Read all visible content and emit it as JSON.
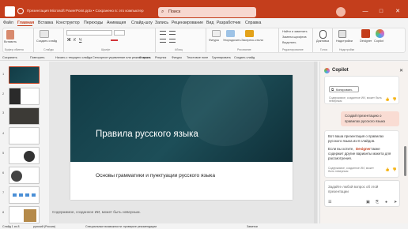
{
  "window": {
    "title": "Презентация Microsoft PowerPoint.pptx • Сохранено в: это компьютер",
    "search_placeholder": "Поиск",
    "minimize": "—",
    "maximize": "□",
    "close": "✕"
  },
  "ribbon": {
    "tabs": [
      "Файл",
      "Главная",
      "Вставка",
      "Конструктор",
      "Переходы",
      "Анимация",
      "Слайд-шоу",
      "Запись",
      "Рецензирование",
      "Вид",
      "Разработчик",
      "Справка"
    ],
    "active_tab": "Главная",
    "record_label": "Запись",
    "paste": "Вставить",
    "new_slide": "Создать слайд",
    "groups": [
      "Буфер обмена",
      "Слайды",
      "Шрифт",
      "Абзац",
      "Рисование",
      "Редактирование",
      "Голос",
      "Надстройки"
    ],
    "find": "Найти и заменить",
    "replace_fonts": "Замена шрифтов",
    "select": "Выделить",
    "shapes": "Фигуры",
    "arrange": "Упорядочить",
    "quick_styles": "Экспресс-стили",
    "dictation": "Диктовка",
    "addins": "Надстройки",
    "designer": "Designer",
    "copilot": "Copilot"
  },
  "quickbar": {
    "items": [
      "Сохранить",
      "Повторить",
      "Начать с текущего слайда",
      "Сенсорное управление или режим мыши",
      "Открыть",
      "Рисунок",
      "Фигуры",
      "Текстовое поле",
      "Группировать",
      "Создать слайд"
    ]
  },
  "thumbnails": [
    "1",
    "2",
    "3",
    "4",
    "5",
    "6",
    "7",
    "8"
  ],
  "slide": {
    "title": "Правила русского языка",
    "subtitle": "Основы грамматики и пунктуации русского языка"
  },
  "disclaimer": "Содержимое, созданное ИИ, может быть неверным.",
  "copilot": {
    "title": "Copilot",
    "copy_button": "Копировать",
    "ai_disclaimer": "Содержимое, созданное ИИ, может быть неверным",
    "user_message_line1": "Создай презентацию о",
    "user_message_line2": "правилах русского языка",
    "reply_line1": "Вот ваша презентация о правилах",
    "reply_line2": "русского языка из 8 слайдов.",
    "reply_line3": "Если вы хотите,",
    "reply_designer": "Designer",
    "reply_line3b": "также",
    "reply_line4": "содержит другие варианты макета для",
    "reply_line5": "рассмотрения.",
    "input_placeholder_line1": "Задайте любой вопрос об этой",
    "input_placeholder_line2": "презентации",
    "counter": "0/2000"
  },
  "status": {
    "slide_info": "Слайд 1 из 8",
    "language": "русский (Россия)",
    "accessibility": "Специальные возможности: проверьте рекомендации",
    "notes": "Заметки"
  },
  "colors": {
    "accent": "#c43e1c",
    "slide_dark": "#123c46"
  }
}
